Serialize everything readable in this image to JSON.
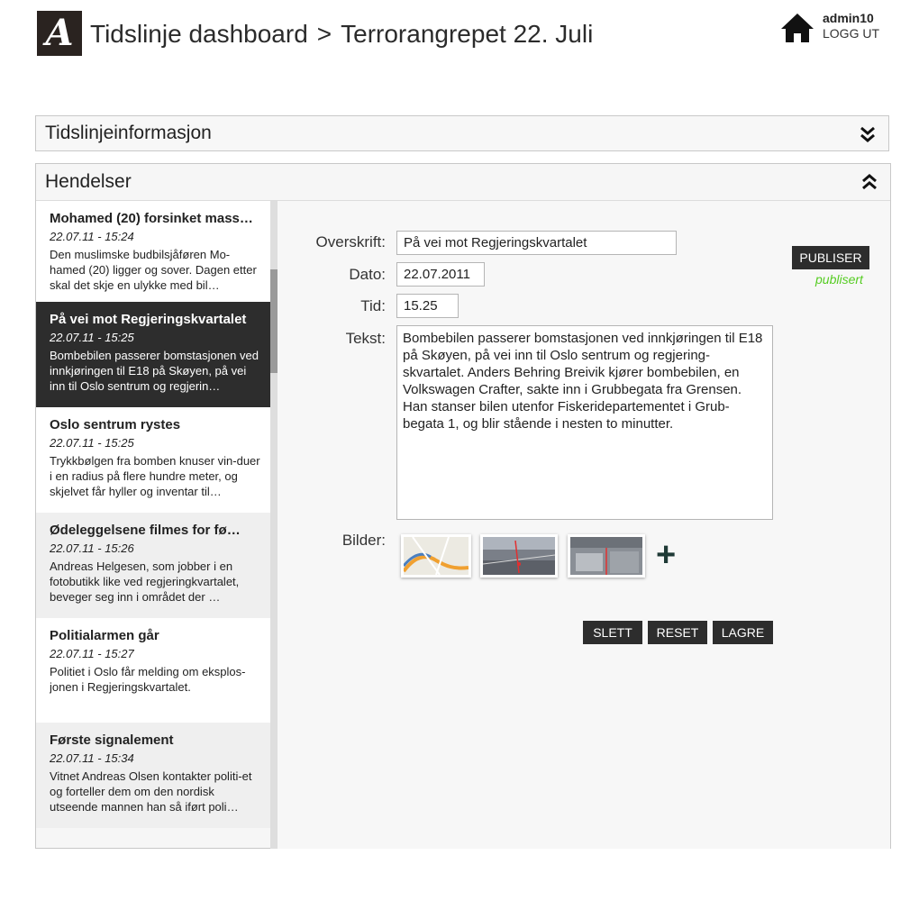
{
  "header": {
    "logo_letter": "A",
    "title": "Tidslinje dashboard",
    "separator": ">",
    "current": "Terrorangrepet 22. Juli",
    "username": "admin10",
    "logout_label": "LOGG UT"
  },
  "info_panel": {
    "title": "Tidslinjeinformasjon"
  },
  "events_panel": {
    "title": "Hendelser",
    "items": [
      {
        "title": "Mohamed (20) forsinket mass…",
        "date": "22.07.11 - 15:24",
        "text": "Den muslimske budbilsjåføren Mo-hamed (20) ligger og sover. Dagen etter skal det skje en ulykke med bil…"
      },
      {
        "title": "På vei mot Regjeringskvartalet",
        "date": "22.07.11 - 15:25",
        "text": "Bombebilen passerer bomstasjonen ved innkjøringen til E18 på Skøyen, på vei inn til Oslo sentrum og regjerin…"
      },
      {
        "title": "Oslo sentrum rystes",
        "date": "22.07.11 - 15:25",
        "text": "Trykkbølgen fra bomben knuser vin-duer i en radius på flere hundre meter, og skjelvet får hyller og inventar til…"
      },
      {
        "title": "Ødeleggelsene filmes for fø…",
        "date": "22.07.11 - 15:26",
        "text": "Andreas Helgesen, som jobber i en fotobutikk like ved regjeringkvartalet, beveger seg inn i området der …"
      },
      {
        "title": "Politialarmen går",
        "date": "22.07.11 - 15:27",
        "text": "Politiet i Oslo får melding om eksplos-jonen i Regjeringskvartalet."
      },
      {
        "title": "Første signalement",
        "date": "22.07.11 - 15:34",
        "text": "Vitnet Andreas Olsen kontakter politi-et og forteller dem om den nordisk utseende mannen han så iført poli…"
      }
    ]
  },
  "editor": {
    "headline_label": "Overskrift:",
    "headline_value": "På vei mot Regjeringskvartalet",
    "date_label": "Dato:",
    "date_value": "22.07.2011",
    "time_label": "Tid:",
    "time_value": "15.25",
    "text_label": "Tekst:",
    "text_value": "Bombebilen passerer bomstasjonen ved innkjøringen til E18 på Skøyen, på vei inn til Oslo sentrum og regjering-skvartalet. Anders Behring Breivik kjører bombebilen, en Volkswagen Crafter, sakte inn i Grubbegata fra Grensen. Han stanser bilen utenfor Fiskeridepartementet i Grub-begata 1, og blir stående i nesten to minutter.",
    "images_label": "Bilder:",
    "add_image": "+",
    "publish_label": "PUBLISER",
    "publish_status": "publisert",
    "delete_label": "SLETT",
    "reset_label": "RESET",
    "save_label": "LAGRE"
  },
  "colors": {
    "dark": "#2d2d2d",
    "published_green": "#55cc22",
    "plus_color": "#1f3a36"
  }
}
